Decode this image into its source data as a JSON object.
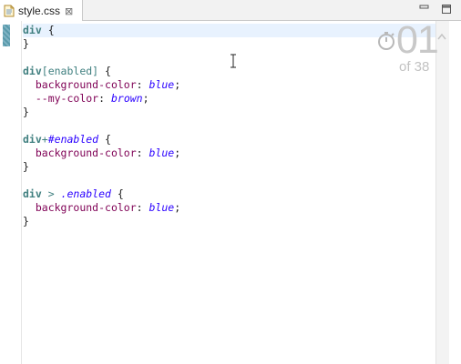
{
  "tab": {
    "label": "style.css",
    "close_glyph": "⊠"
  },
  "code": {
    "lines": [
      [
        {
          "t": "div",
          "c": "sel"
        },
        {
          "t": " {",
          "c": "br"
        }
      ],
      [
        {
          "t": "}",
          "c": "br"
        }
      ],
      [],
      [
        {
          "t": "div",
          "c": "sel"
        },
        {
          "t": "[enabled]",
          "c": "attr"
        },
        {
          "t": " {",
          "c": "br"
        }
      ],
      [
        {
          "t": "  ",
          "c": "br"
        },
        {
          "t": "background-color",
          "c": "prop"
        },
        {
          "t": ": ",
          "c": "br"
        },
        {
          "t": "blue",
          "c": "val"
        },
        {
          "t": ";",
          "c": "br"
        }
      ],
      [
        {
          "t": "  ",
          "c": "br"
        },
        {
          "t": "--my-color",
          "c": "prop"
        },
        {
          "t": ": ",
          "c": "br"
        },
        {
          "t": "brown",
          "c": "val"
        },
        {
          "t": ";",
          "c": "br"
        }
      ],
      [
        {
          "t": "}",
          "c": "br"
        }
      ],
      [],
      [
        {
          "t": "div",
          "c": "sel"
        },
        {
          "t": "+",
          "c": "sym"
        },
        {
          "t": "#enabled",
          "c": "val"
        },
        {
          "t": " {",
          "c": "br"
        }
      ],
      [
        {
          "t": "  ",
          "c": "br"
        },
        {
          "t": "background-color",
          "c": "prop"
        },
        {
          "t": ": ",
          "c": "br"
        },
        {
          "t": "blue",
          "c": "val"
        },
        {
          "t": ";",
          "c": "br"
        }
      ],
      [
        {
          "t": "}",
          "c": "br"
        }
      ],
      [],
      [
        {
          "t": "div",
          "c": "sel"
        },
        {
          "t": " > ",
          "c": "sym"
        },
        {
          "t": ".enabled",
          "c": "val"
        },
        {
          "t": " {",
          "c": "br"
        }
      ],
      [
        {
          "t": "  ",
          "c": "br"
        },
        {
          "t": "background-color",
          "c": "prop"
        },
        {
          "t": ": ",
          "c": "br"
        },
        {
          "t": "blue",
          "c": "val"
        },
        {
          "t": ";",
          "c": "br"
        }
      ],
      [
        {
          "t": "}",
          "c": "br"
        }
      ]
    ],
    "current_line": 0
  },
  "counter": {
    "number": "01",
    "of_text": "of 38",
    "icon": "stopwatch-icon",
    "up_icon": "chevron-up-icon"
  },
  "colors": {
    "selector": "#3f7f7f",
    "property": "#7f0055",
    "value": "#2a00ff",
    "current_line": "#e8f2fe"
  }
}
